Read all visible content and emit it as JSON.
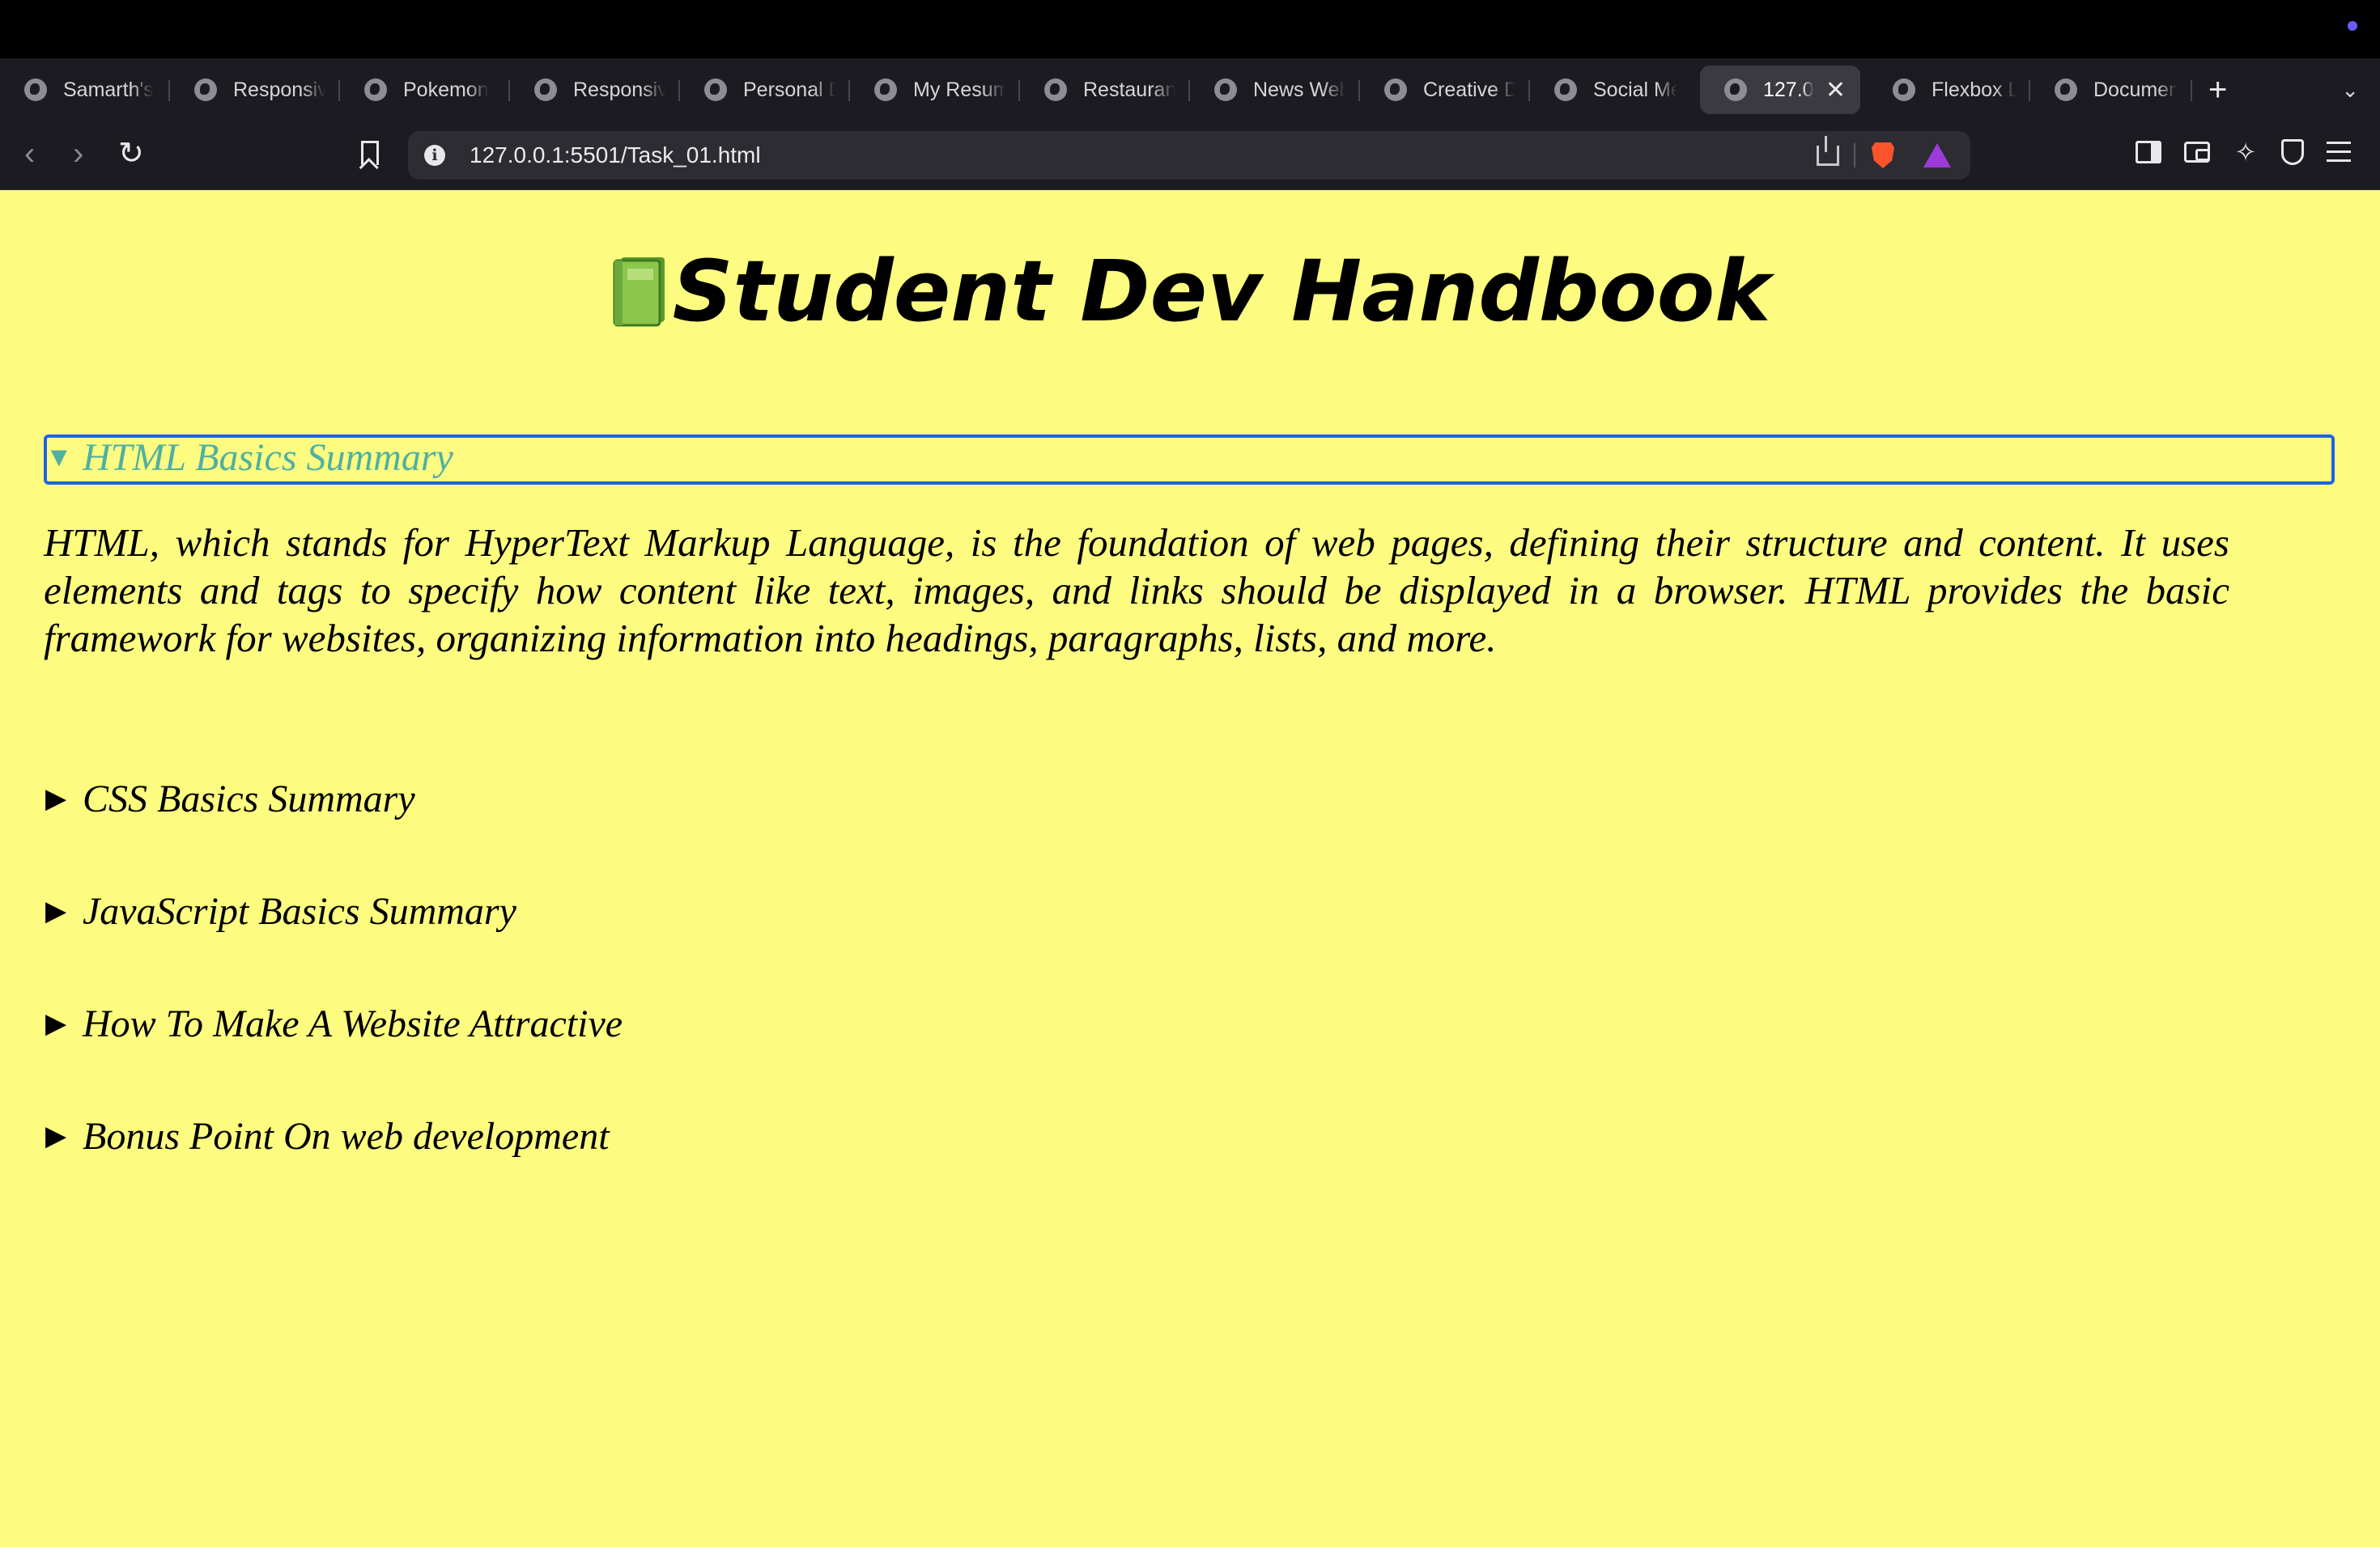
{
  "browser": {
    "tabs": [
      {
        "label": "Samarth's"
      },
      {
        "label": "Responsive"
      },
      {
        "label": "Pokemon"
      },
      {
        "label": "Responsive"
      },
      {
        "label": "Personal D"
      },
      {
        "label": "My Resume"
      },
      {
        "label": "Restaurant"
      },
      {
        "label": "News Web"
      },
      {
        "label": "Creative D"
      },
      {
        "label": "Social Me"
      },
      {
        "label": "127.0",
        "active": true
      },
      {
        "label": "Flexbox L"
      },
      {
        "label": "Documen"
      }
    ],
    "close_tab_glyph": "✕",
    "new_tab_glyph": "+",
    "tab_menu_glyph": "⌄",
    "url": "127.0.0.1:5501/Task_01.html",
    "info_glyph": "i",
    "icons": [
      "back-icon",
      "forward-icon",
      "reload-icon",
      "bookmark-icon",
      "share-icon",
      "brave-shields-icon",
      "bat-rewards-icon",
      "sidebar-icon",
      "wallet-icon",
      "leo-ai-icon",
      "vpn-shield-icon",
      "menu-icon"
    ]
  },
  "page": {
    "background": "#fdfc80",
    "title": "Student Dev Handbook",
    "title_emoji": "book-icon",
    "sections": [
      {
        "label": "HTML Basics Summary",
        "open": true,
        "content": "HTML, which stands for HyperText Markup Language, is the foundation of web pages, defining their structure and content. It uses elements and tags to specify how content like text, images, and links should be displayed in a browser. HTML provides the basic framework for websites, organizing information into headings, paragraphs, lists, and more."
      },
      {
        "label": "CSS Basics Summary",
        "open": false
      },
      {
        "label": "JavaScript Basics Summary",
        "open": false
      },
      {
        "label": "How To Make A Website Attractive",
        "open": false
      },
      {
        "label": "Bonus Point On web development",
        "open": false
      }
    ],
    "open_arrow": "▼",
    "closed_arrow": "▶",
    "focus_color": "#1e62e8",
    "open_summary_color": "#4fb0a0"
  }
}
